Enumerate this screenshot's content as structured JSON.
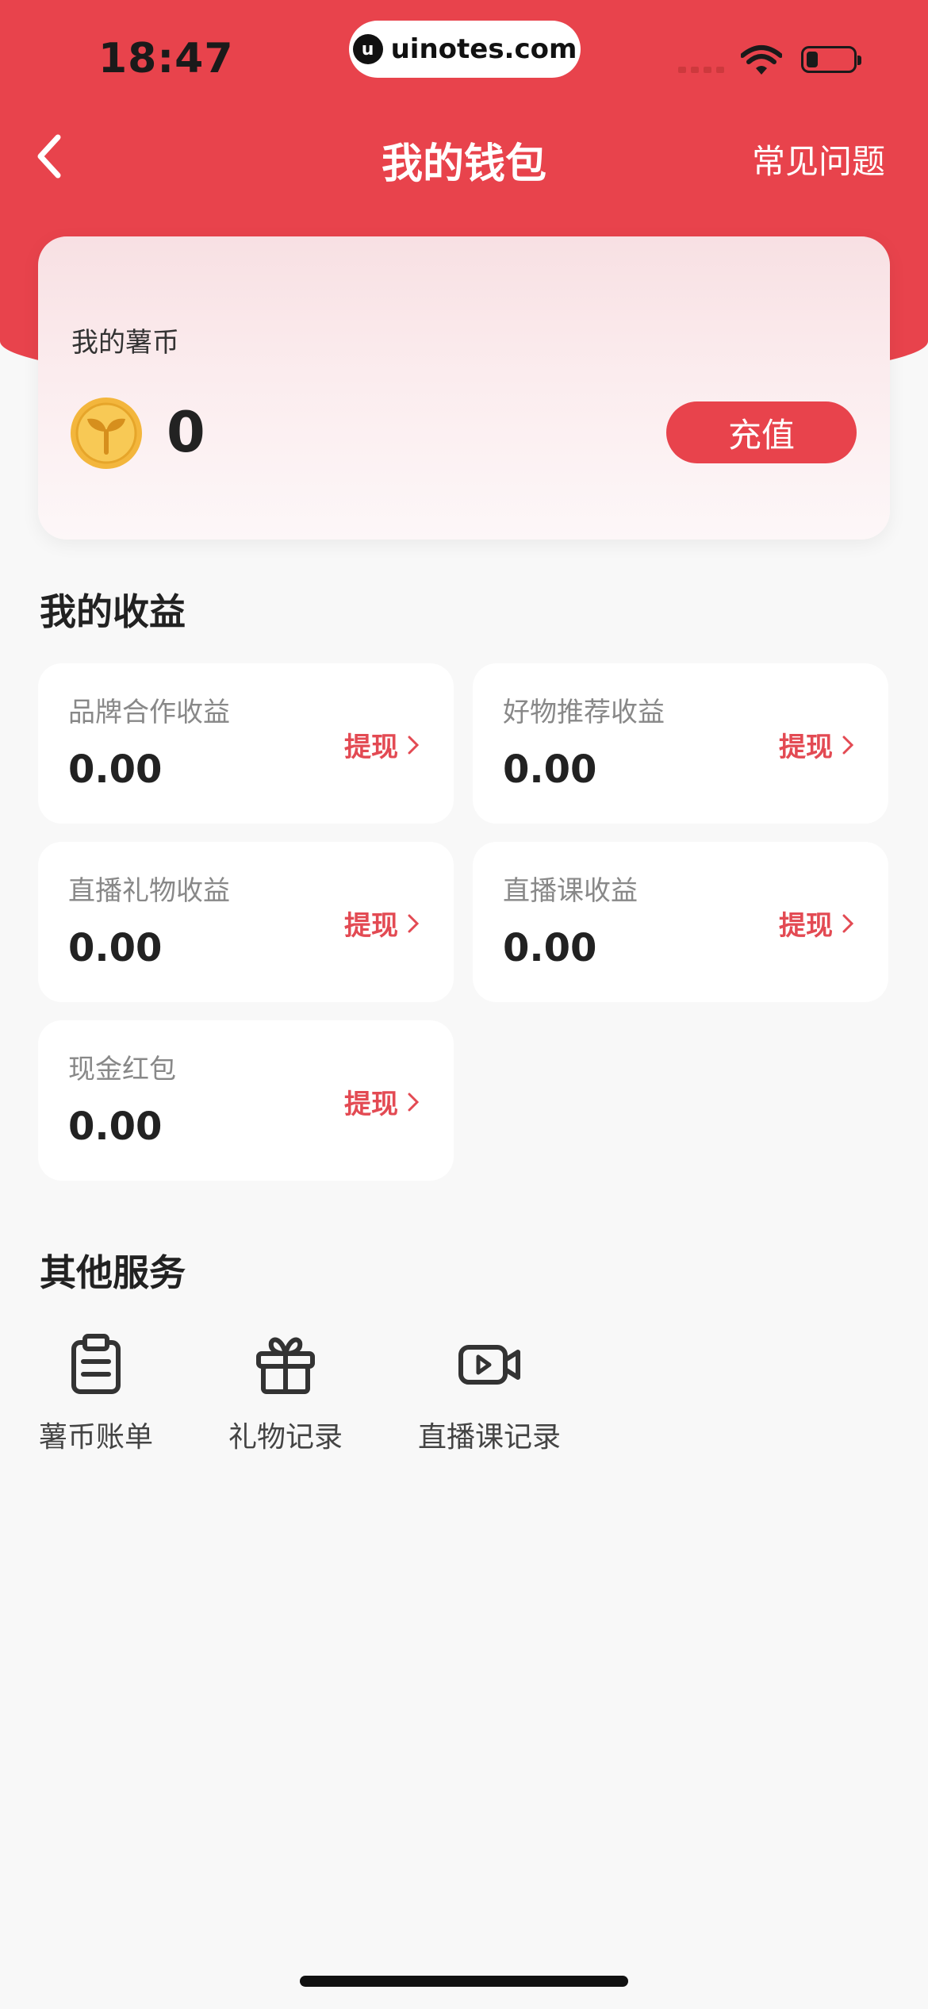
{
  "status_bar": {
    "time": "18:47",
    "url": "uinotes.com"
  },
  "nav": {
    "title": "我的钱包",
    "faq_label": "常见问题"
  },
  "coin_card": {
    "label": "我的薯币",
    "value": "0",
    "recharge_label": "充值"
  },
  "earnings": {
    "title": "我的收益",
    "items": [
      {
        "label": "品牌合作收益",
        "value": "0.00",
        "action": "提现"
      },
      {
        "label": "好物推荐收益",
        "value": "0.00",
        "action": "提现"
      },
      {
        "label": "直播礼物收益",
        "value": "0.00",
        "action": "提现"
      },
      {
        "label": "直播课收益",
        "value": "0.00",
        "action": "提现"
      },
      {
        "label": "现金红包",
        "value": "0.00",
        "action": "提现"
      }
    ]
  },
  "services": {
    "title": "其他服务",
    "items": [
      {
        "label": "薯币账单",
        "icon": "clipboard-icon"
      },
      {
        "label": "礼物记录",
        "icon": "gift-icon"
      },
      {
        "label": "直播课记录",
        "icon": "video-icon"
      }
    ]
  },
  "colors": {
    "accent": "#e8434c",
    "background": "#f8f8f8"
  }
}
